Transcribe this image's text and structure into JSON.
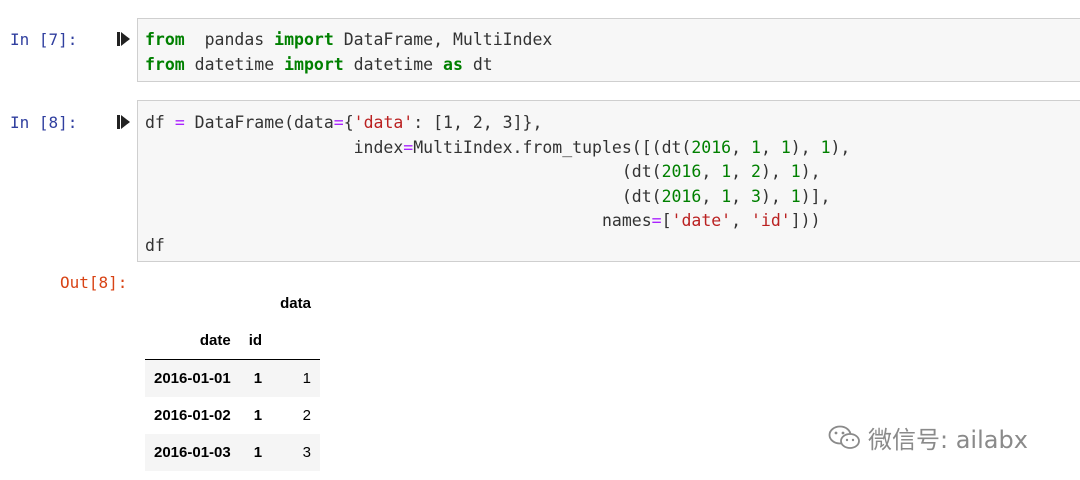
{
  "cells": [
    {
      "prompt": "In  [7]:",
      "lines": [
        [
          [
            "kw",
            "from"
          ],
          [
            "",
            "  pandas "
          ],
          [
            "kw",
            "import"
          ],
          [
            "",
            " DataFrame, MultiIndex"
          ]
        ],
        [
          [
            "kw",
            "from"
          ],
          [
            "",
            " datetime "
          ],
          [
            "kw",
            "import"
          ],
          [
            "",
            " datetime "
          ],
          [
            "kw",
            "as"
          ],
          [
            "",
            " dt"
          ]
        ]
      ]
    },
    {
      "prompt": "In  [8]:",
      "lines": [
        [
          [
            "",
            "df "
          ],
          [
            "op",
            "="
          ],
          [
            "",
            " DataFrame(data"
          ],
          [
            "op",
            "="
          ],
          [
            "",
            "{"
          ],
          [
            "str",
            "'data'"
          ],
          [
            "",
            ": [1, 2, 3]},"
          ]
        ],
        [
          [
            "",
            "                     index"
          ],
          [
            "op",
            "="
          ],
          [
            "",
            "MultiIndex.from_tuples([(dt("
          ],
          [
            "num",
            "2016"
          ],
          [
            "",
            ", "
          ],
          [
            "num",
            "1"
          ],
          [
            "",
            ", "
          ],
          [
            "num",
            "1"
          ],
          [
            "",
            "), "
          ],
          [
            "num",
            "1"
          ],
          [
            "",
            "),"
          ]
        ],
        [
          [
            "",
            "                                                (dt("
          ],
          [
            "num",
            "2016"
          ],
          [
            "",
            ", "
          ],
          [
            "num",
            "1"
          ],
          [
            "",
            ", "
          ],
          [
            "num",
            "2"
          ],
          [
            "",
            "), "
          ],
          [
            "num",
            "1"
          ],
          [
            "",
            "),"
          ]
        ],
        [
          [
            "",
            "                                                (dt("
          ],
          [
            "num",
            "2016"
          ],
          [
            "",
            ", "
          ],
          [
            "num",
            "1"
          ],
          [
            "",
            ", "
          ],
          [
            "num",
            "3"
          ],
          [
            "",
            "), "
          ],
          [
            "num",
            "1"
          ],
          [
            "",
            ")],"
          ]
        ],
        [
          [
            "",
            "                                              names"
          ],
          [
            "op",
            "="
          ],
          [
            "",
            "["
          ],
          [
            "str",
            "'date'"
          ],
          [
            "",
            ", "
          ],
          [
            "str",
            "'id'"
          ],
          [
            "",
            "]))"
          ]
        ],
        [
          [
            "",
            "df"
          ]
        ]
      ]
    }
  ],
  "output": {
    "prompt": "Out[8]:",
    "table": {
      "column_header": "data",
      "index_names": [
        "date",
        "id"
      ],
      "rows": [
        {
          "date": "2016-01-01",
          "id": "1",
          "data": "1"
        },
        {
          "date": "2016-01-02",
          "id": "1",
          "data": "2"
        },
        {
          "date": "2016-01-03",
          "id": "1",
          "data": "3"
        }
      ]
    }
  },
  "watermark": {
    "text": "微信号: ailabx",
    "icon": "wechat-icon"
  },
  "colors": {
    "prompt_in": "#303f9f",
    "prompt_out": "#d84315",
    "keyword": "#008000",
    "string": "#ba2121",
    "operator": "#aa22ff"
  }
}
